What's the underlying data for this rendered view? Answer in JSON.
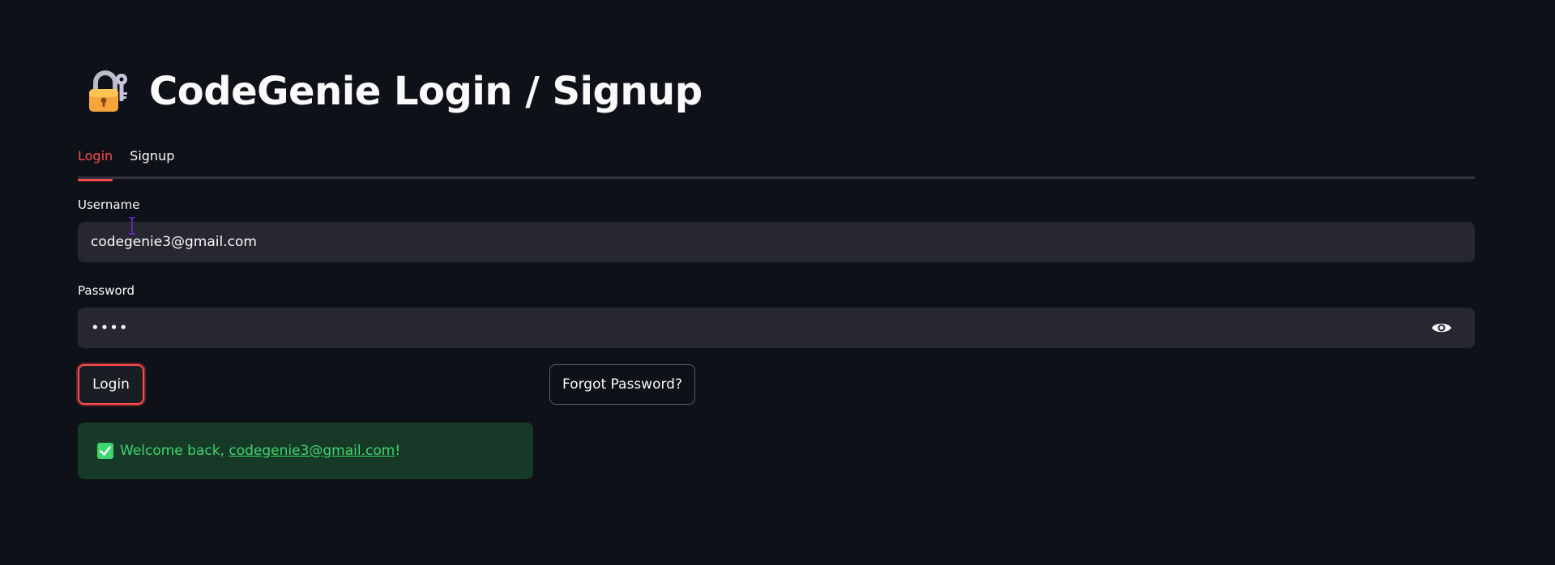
{
  "header": {
    "title": "CodeGenie Login / Signup",
    "icon": "lock-with-key-icon"
  },
  "tabs": [
    {
      "label": "Login",
      "active": true
    },
    {
      "label": "Signup",
      "active": false
    }
  ],
  "form": {
    "username_label": "Username",
    "username_value": "codegenie3@gmail.com",
    "password_label": "Password",
    "password_masked": "••••"
  },
  "buttons": {
    "login_label": "Login",
    "forgot_label": "Forgot Password?"
  },
  "alert": {
    "prefix": "Welcome back, ",
    "user_link": "codegenie3@gmail.com",
    "suffix": "!",
    "icon": "check-mark-icon"
  },
  "colors": {
    "background": "#0e1117",
    "accent": "#ff4b4b",
    "field_background": "#262730",
    "success_background": "#173928",
    "success_text": "#3dd56d"
  }
}
